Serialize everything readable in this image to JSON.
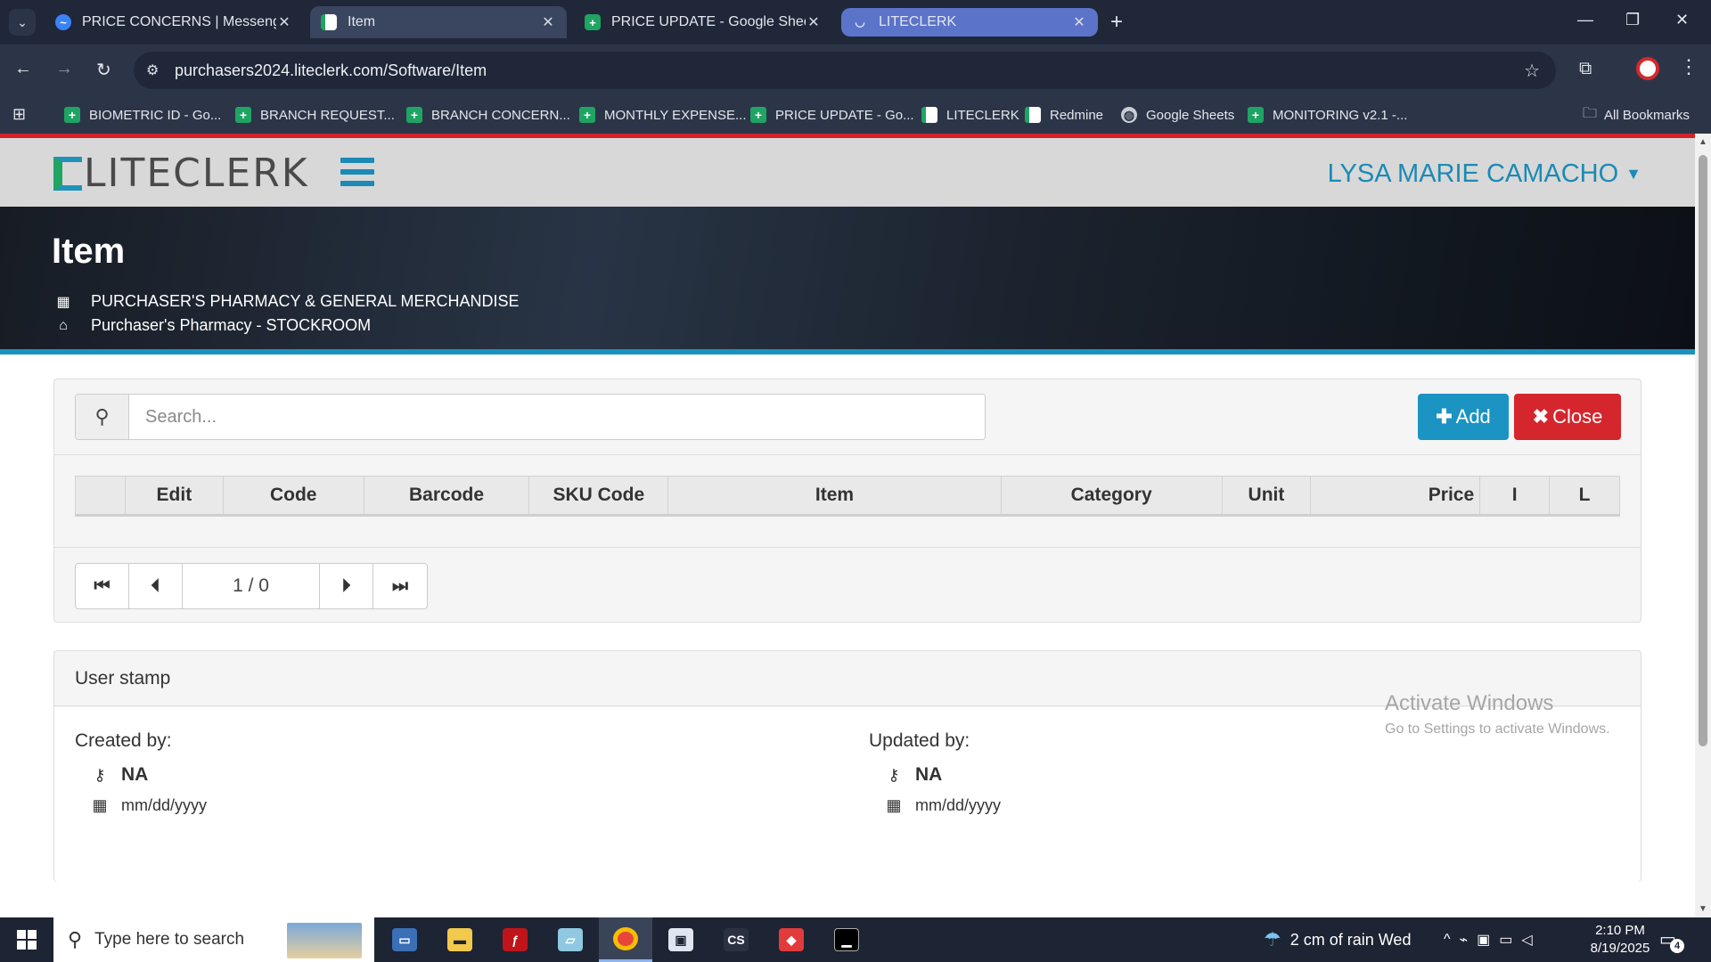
{
  "browser": {
    "tabs": [
      {
        "title": "PRICE CONCERNS | Messenger",
        "icon": "messenger-icon"
      },
      {
        "title": "Item",
        "icon": "liteclerk-icon",
        "active": true
      },
      {
        "title": "PRICE UPDATE - Google Sheets",
        "icon": "sheets-icon"
      },
      {
        "title": "LITECLERK",
        "icon": "loading-icon",
        "highlighted": true
      }
    ],
    "url": "purchasers2024.liteclerk.com/Software/Item",
    "bookmarks": [
      {
        "label": "BIOMETRIC ID - Go...",
        "icon": "sheets-icon"
      },
      {
        "label": "BRANCH REQUEST...",
        "icon": "sheets-icon"
      },
      {
        "label": "BRANCH CONCERN...",
        "icon": "sheets-icon"
      },
      {
        "label": "MONTHLY EXPENSE...",
        "icon": "sheets-icon"
      },
      {
        "label": "PRICE UPDATE - Go...",
        "icon": "sheets-icon"
      },
      {
        "label": "LITECLERK",
        "icon": "liteclerk-icon"
      },
      {
        "label": "Redmine",
        "icon": "liteclerk-icon"
      },
      {
        "label": "Google Sheets",
        "icon": "globe-icon"
      },
      {
        "label": "MONITORING v2.1 -...",
        "icon": "sheets-icon"
      }
    ],
    "all_bookmarks": "All Bookmarks"
  },
  "app": {
    "logo_text": "LITECLERK",
    "user_name": "LYSA MARIE CAMACHO",
    "page_title": "Item",
    "company": "PURCHASER'S PHARMACY & GENERAL MERCHANDISE",
    "branch": "Purchaser's Pharmacy - STOCKROOM",
    "search_placeholder": "Search...",
    "add_label": "Add",
    "close_label": "Close",
    "columns": [
      "",
      "Edit",
      "Code",
      "Barcode",
      "SKU Code",
      "Item",
      "Category",
      "Unit",
      "Price",
      "I",
      "L"
    ],
    "pager_info": "1 / 0",
    "user_stamp": {
      "title": "User stamp",
      "created_label": "Created by:",
      "created_by": "NA",
      "created_date": "mm/dd/yyyy",
      "updated_label": "Updated by:",
      "updated_by": "NA",
      "updated_date": "mm/dd/yyyy"
    }
  },
  "watermark": {
    "line1": "Activate Windows",
    "line2": "Go to Settings to activate Windows."
  },
  "taskbar": {
    "search_placeholder": "Type here to search",
    "weather": "2 cm of rain Wed",
    "time": "2:10 PM",
    "date": "8/19/2025",
    "notifications": "4"
  },
  "colors": {
    "accent": "#1b93c3",
    "danger": "#d5262d",
    "header_red": "#d3222a",
    "brand_green": "#1fa463"
  }
}
